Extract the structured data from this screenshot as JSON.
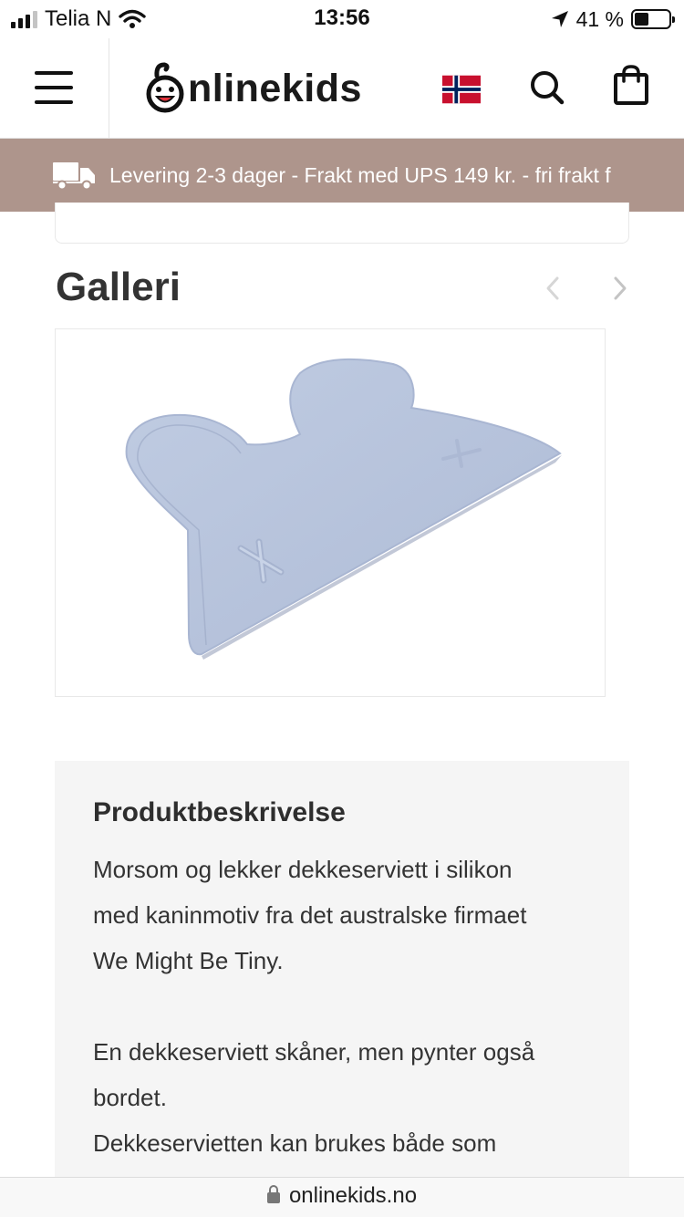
{
  "status_bar": {
    "carrier": "Telia N",
    "time": "13:56",
    "battery_percent": "41 %",
    "battery_level": 0.41
  },
  "header": {
    "logo_text": "nlinekids",
    "logo_alt": "Onlinekids",
    "icons": [
      "menu-icon",
      "norway-flag-icon",
      "search-icon",
      "shopping-bag-icon"
    ]
  },
  "banner": {
    "icon": "truck-icon",
    "text": "Levering 2-3 dager - Frakt med UPS 149 kr. - fri frakt f"
  },
  "gallery": {
    "title": "Galleri",
    "prev_icon": "chevron-left-icon",
    "next_icon": "chevron-right-icon",
    "image_subject": "bunny-shaped silicone placemat",
    "image_color": "#b7c4dc"
  },
  "description": {
    "title": "Produktbeskrivelse",
    "lines_1": [
      "Morsom og lekker dekkeserviett i silikon",
      "med kaninmotiv fra det australske firmaet",
      "We Might Be Tiny."
    ],
    "lines_2": [
      "En dekkeserviett skåner, men pynter også",
      "bordet.",
      "Dekkeservietten kan brukes både som"
    ]
  },
  "url_bar": {
    "domain": "onlinekids.no"
  },
  "colors": {
    "banner_bg": "#ae958c",
    "description_bg": "#f5f5f5",
    "flag_red": "#c8102e",
    "flag_blue": "#00205b"
  }
}
